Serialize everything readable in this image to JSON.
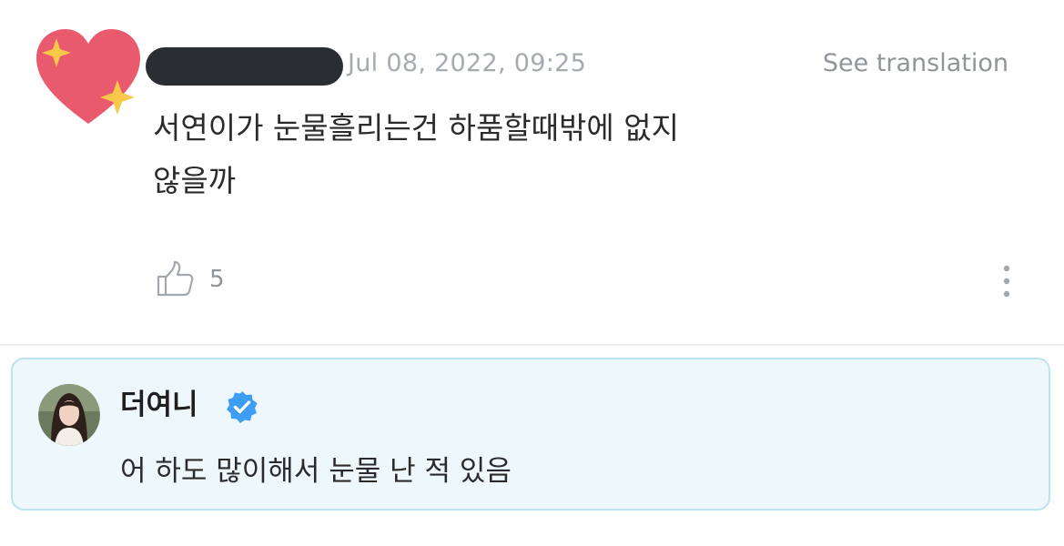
{
  "comment": {
    "author_name": "",
    "timestamp": "Jul 08, 2022, 09:25",
    "translate_label": "See translation",
    "body_lines": [
      "서연이가 눈물흘리는건 하품할때밖에 없지",
      "않을까"
    ],
    "like_count": "5",
    "icons": {
      "avatar": "heart-sparkles-icon",
      "like": "thumbs-up-icon",
      "more": "vertical-ellipsis-icon"
    }
  },
  "reply": {
    "author_name": "더여니",
    "body": "어 하도 많이해서 눈물 난 적 있음",
    "icons": {
      "verified": "verified-badge-icon"
    }
  },
  "colors": {
    "heart": "#e95a6f",
    "sparkle": "#f7c84a",
    "reply_background": "#eef8fc",
    "reply_border": "#bde3ee",
    "verified": "#3d9df2",
    "muted_text": "#a6abb1"
  }
}
